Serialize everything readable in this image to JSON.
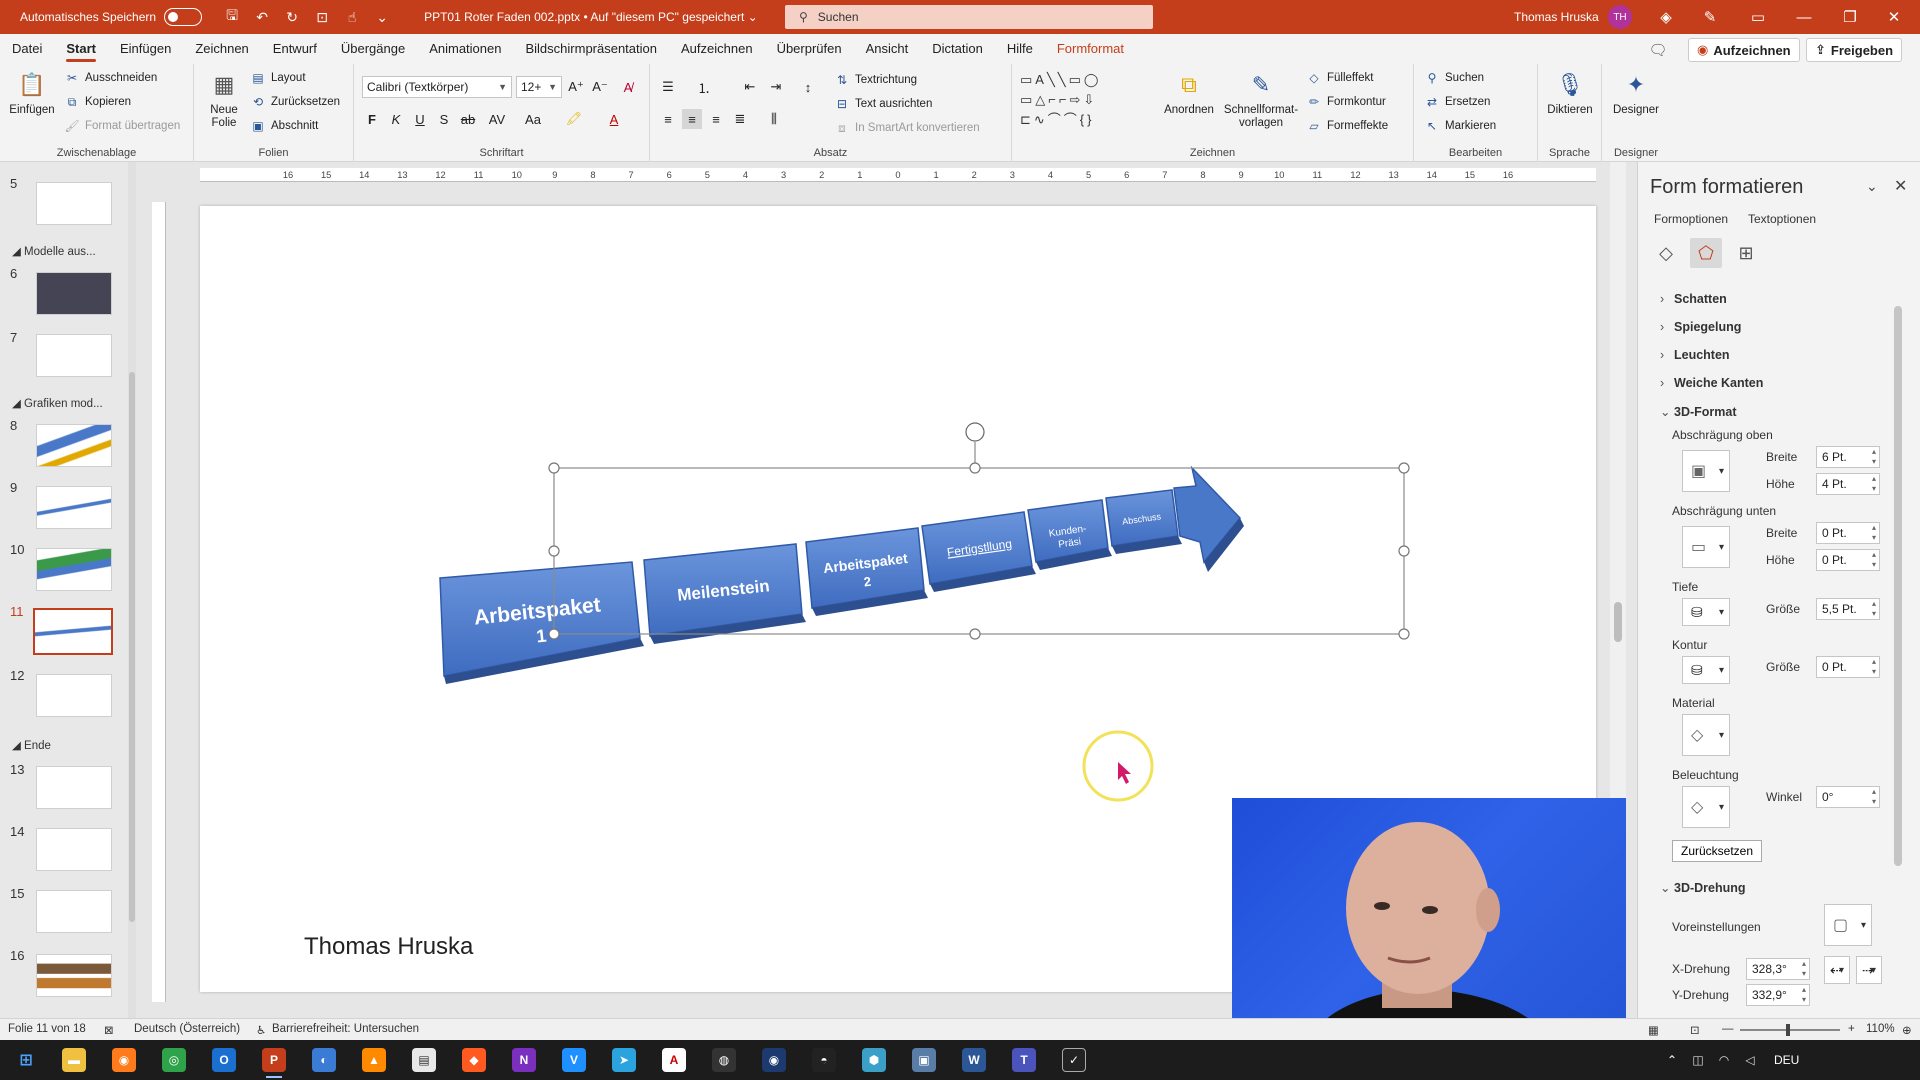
{
  "titlebar": {
    "autosave_label": "Automatisches Speichern",
    "doc_title": "PPT01 Roter Faden 002.pptx • Auf \"diesem PC\" gespeichert ⌄",
    "search_placeholder": "Suchen",
    "user_name": "Thomas Hruska",
    "user_initials": "TH"
  },
  "menu": {
    "tabs": [
      "Datei",
      "Start",
      "Einfügen",
      "Zeichnen",
      "Entwurf",
      "Übergänge",
      "Animationen",
      "Bildschirmpräsentation",
      "Aufzeichnen",
      "Überprüfen",
      "Ansicht",
      "Dictation",
      "Hilfe",
      "Formformat"
    ],
    "record_button": "Aufzeichnen",
    "share_button": "Freigeben"
  },
  "ribbon": {
    "clipboard": {
      "paste": "Einfügen",
      "cut": "Ausschneiden",
      "copy": "Kopieren",
      "format_painter": "Format übertragen",
      "label": "Zwischenablage"
    },
    "slides": {
      "new_slide": "Neue Folie",
      "layout": "Layout",
      "reset": "Zurücksetzen",
      "section": "Abschnitt",
      "label": "Folien"
    },
    "font": {
      "font_name": "Calibri (Textkörper)",
      "font_size": "12+",
      "label": "Schriftart",
      "bold": "F",
      "italic": "K",
      "underline": "U",
      "shadow": "S",
      "strike": "ab",
      "spacing": "AV",
      "case": "Aa"
    },
    "paragraph": {
      "text_direction": "Textrichtung",
      "align_text": "Text ausrichten",
      "smartart": "In SmartArt konvertieren",
      "label": "Absatz"
    },
    "drawing": {
      "arrange": "Anordnen",
      "quick_styles": "Schnellformat-vorlagen",
      "fill": "Fülleffekt",
      "outline": "Formkontur",
      "effects": "Formeffekte",
      "label": "Zeichnen"
    },
    "editing": {
      "find": "Suchen",
      "replace": "Ersetzen",
      "select": "Markieren",
      "label": "Bearbeiten"
    },
    "voice": {
      "dictate": "Diktieren",
      "label": "Sprache"
    },
    "designer": {
      "designer": "Designer",
      "label": "Designer"
    }
  },
  "thumbnails": {
    "sections": [
      "Modelle aus...",
      "Grafiken mod...",
      "Ende"
    ],
    "slides": [
      "5",
      "6",
      "7",
      "8",
      "9",
      "10",
      "11",
      "12",
      "13",
      "14",
      "15",
      "16"
    ]
  },
  "slide": {
    "segments": [
      "Arbeitspaket 1",
      "Meilenstein",
      "Arbeitspaket 2",
      "Fertigstllung",
      "Kunden-Präsi",
      "Abschuss"
    ],
    "author": "Thomas Hruska"
  },
  "ruler_ticks": [
    "16",
    "15",
    "14",
    "13",
    "12",
    "11",
    "10",
    "9",
    "8",
    "7",
    "6",
    "5",
    "4",
    "3",
    "2",
    "1",
    "0",
    "1",
    "2",
    "3",
    "4",
    "5",
    "6",
    "7",
    "8",
    "9",
    "10",
    "11",
    "12",
    "13",
    "14",
    "15",
    "16"
  ],
  "format_pane": {
    "title": "Form formatieren",
    "tabs": [
      "Formoptionen",
      "Textoptionen"
    ],
    "sections": {
      "shadow": "Schatten",
      "reflection": "Spiegelung",
      "glow": "Leuchten",
      "soft_edges": "Weiche Kanten",
      "format3d": "3D-Format",
      "rotation3d": "3D-Drehung"
    },
    "bevel_top": {
      "label": "Abschrägung oben",
      "width_label": "Breite",
      "width": "6 Pt.",
      "height_label": "Höhe",
      "height": "4 Pt."
    },
    "bevel_bottom": {
      "label": "Abschrägung unten",
      "width_label": "Breite",
      "width": "0 Pt.",
      "height_label": "Höhe",
      "height": "0 Pt."
    },
    "depth": {
      "label": "Tiefe",
      "size_label": "Größe",
      "size": "5,5 Pt."
    },
    "contour": {
      "label": "Kontur",
      "size_label": "Größe",
      "size": "0 Pt."
    },
    "material": {
      "label": "Material"
    },
    "lighting": {
      "label": "Beleuchtung",
      "angle_label": "Winkel",
      "angle": "0°"
    },
    "reset_button": "Zurücksetzen",
    "presets_label": "Voreinstellungen",
    "x_rotation_label": "X-Drehung",
    "x_rotation": "328,3°",
    "y_rotation_label": "Y-Drehung",
    "y_rotation": "332,9°"
  },
  "statusbar": {
    "slide_info": "Folie 11 von 18",
    "language": "Deutsch (Österreich)",
    "accessibility": "Barrierefreiheit: Untersuchen",
    "zoom": "110%"
  },
  "taskbar": {
    "language": "DEU"
  },
  "colors": {
    "accent": "#c43e1c",
    "shape_blue": "#4a78c8"
  }
}
